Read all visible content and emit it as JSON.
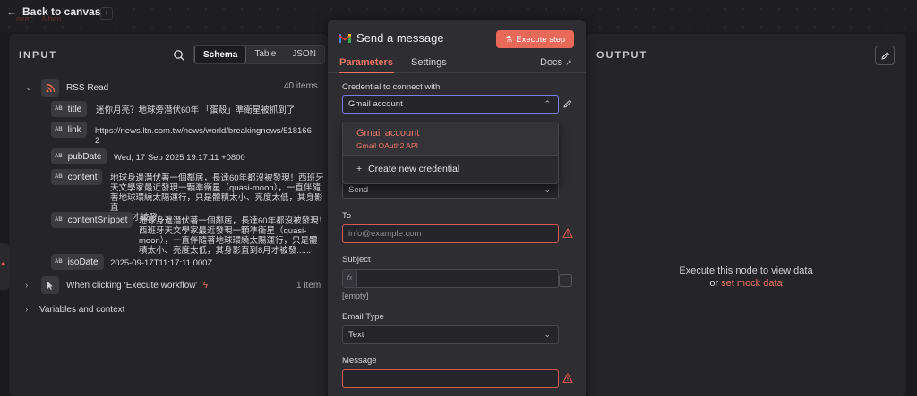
{
  "topbar": {
    "back_label": "Back to canvas",
    "ghost_tab": "exec ...Nhan"
  },
  "input_panel": {
    "title": "INPUT",
    "view_tabs": [
      "Schema",
      "Table",
      "JSON"
    ],
    "active_view": "Schema",
    "rss_node": {
      "label": "RSS Read",
      "count": "40 items"
    },
    "fields": [
      {
        "name": "title",
        "value": "迷你月亮？地球旁潛伏60年 「蛋殼」準衛星被抓到了"
      },
      {
        "name": "link",
        "value_lines": [
          "https://news.ltn.com.tw/news/world/breakingnews/518166",
          "2"
        ]
      },
      {
        "name": "pubDate",
        "value": "Wed, 17 Sep 2025 19:17:11 +0800"
      },
      {
        "name": "content",
        "value_lines": [
          "地球身邊潛伏著一個鄰居，長達60年都沒被發現！西班牙",
          "天文學家最近發現一顆準衛星（quasi-moon），一直伴隨",
          "著地球環繞太陽運行，只是體積太小、亮度太低，其身影直",
          "到8月才被發......"
        ]
      },
      {
        "name": "contentSnippet",
        "value_lines": [
          "地球身邊潛伏著一個鄰居，長達60年都沒被發現！",
          "西班牙天文學家最近發現一顆準衛星（quasi-",
          "moon），一直伴隨著地球環繞太陽運行，只是體",
          "積太小、亮度太低，其身影直到8月才被發......"
        ]
      },
      {
        "name": "isoDate",
        "value": "2025-09-17T11:17:11.000Z"
      }
    ],
    "trigger_node": {
      "label": "When clicking ‘Execute workflow’",
      "count": "1 item"
    },
    "variables_label": "Variables and context"
  },
  "dialog": {
    "title": "Send a message",
    "execute_label": "Execute step",
    "tabs": {
      "parameters": "Parameters",
      "settings": "Settings",
      "docs": "Docs"
    },
    "credential_label": "Credential to connect with",
    "credential_value": "Gmail account",
    "dropdown": {
      "item_title": "Gmail account",
      "item_sub": "Gmail OAuth2 API",
      "create_label": "Create new credential"
    },
    "operation_value": "Send",
    "to_label": "To",
    "to_placeholder": "info@example.com",
    "subject_label": "Subject",
    "subject_empty_hint": "[empty]",
    "email_type_label": "Email Type",
    "email_type_value": "Text",
    "message_label": "Message"
  },
  "output_panel": {
    "title": "OUTPUT",
    "message_line1": "Execute this node to view data",
    "message_or": "or",
    "mock_link": "set mock data"
  },
  "colors": {
    "accent": "#ef7565",
    "execute_button": "#ea6a5a",
    "error_border": "#d65a55",
    "focus_border": "#7a7cf0",
    "panel_bg": "#252528",
    "dialog_bg": "#2e2e32"
  }
}
